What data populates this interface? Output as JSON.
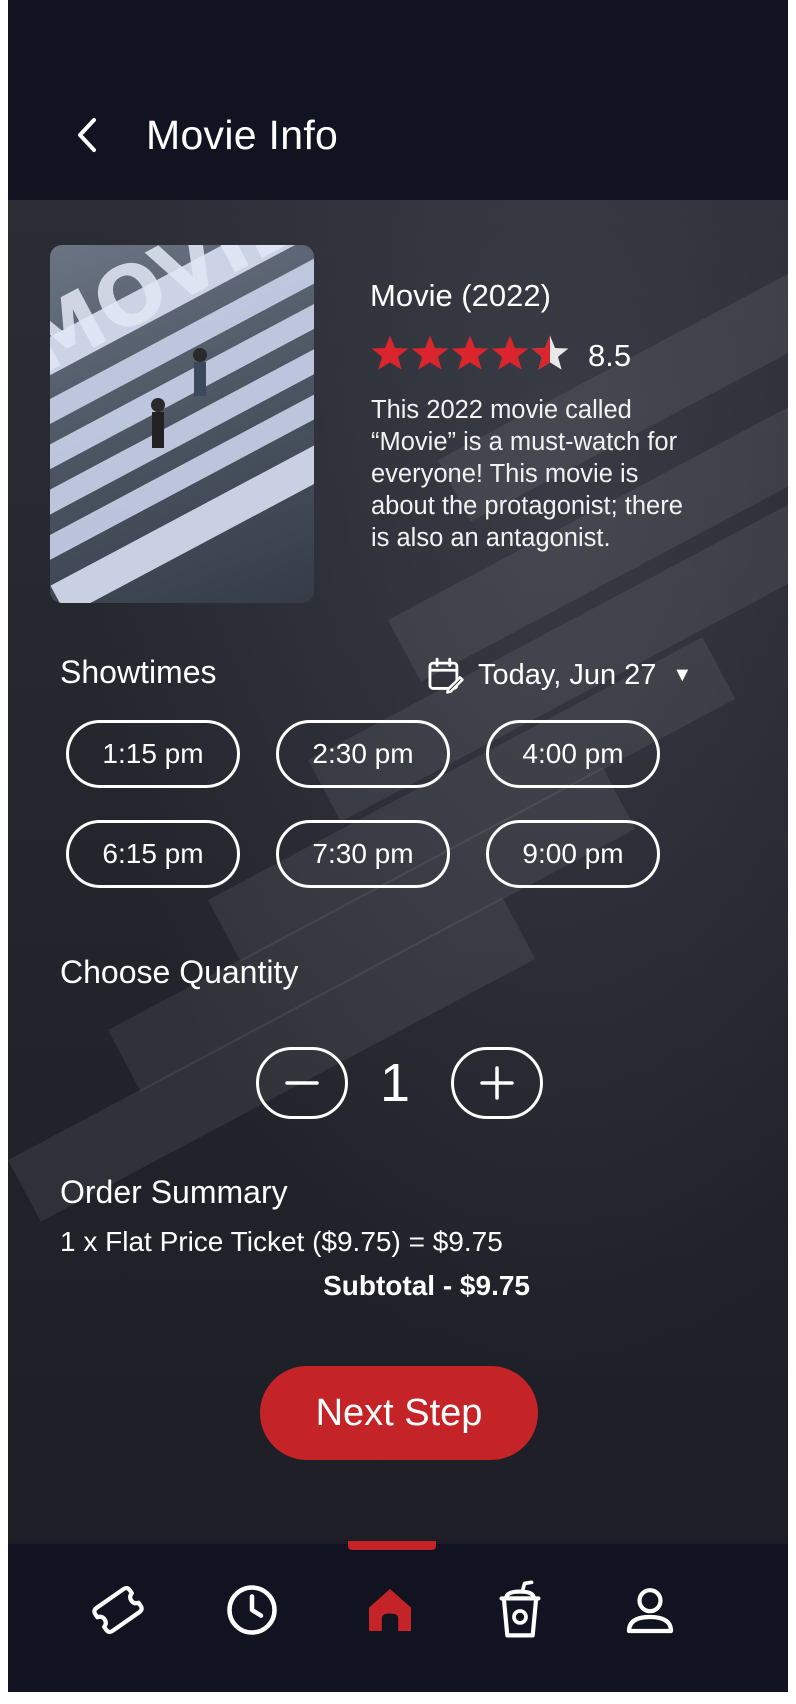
{
  "header": {
    "title": "Movie Info"
  },
  "movie": {
    "title": "Movie (2022)",
    "rating": "8.5",
    "rating_stars": 4.5,
    "description": "This 2022 movie called “Movie” is a must-watch for everyone! This movie is about the protagonist; there is also an antagonist.",
    "poster_text": "MOVIE"
  },
  "showtimes": {
    "title": "Showtimes",
    "date": "Today, Jun 27",
    "times": [
      "1:15 pm",
      "2:30 pm",
      "4:00 pm",
      "6:15 pm",
      "7:30 pm",
      "9:00 pm"
    ]
  },
  "quantity": {
    "title": "Choose Quantity",
    "value": "1"
  },
  "order": {
    "title": "Order Summary",
    "line": "1 x Flat Price Ticket ($9.75) = $9.75",
    "subtotal": "Subtotal - $9.75"
  },
  "next_button": "Next Step",
  "nav": {
    "items": [
      "ticket-icon",
      "clock-icon",
      "home-icon",
      "drink-icon",
      "profile-icon"
    ],
    "active_index": 2
  },
  "colors": {
    "accent": "#c42428",
    "header_bg": "#121320",
    "body_bg": "#1c1d26",
    "star": "#d9252b"
  }
}
